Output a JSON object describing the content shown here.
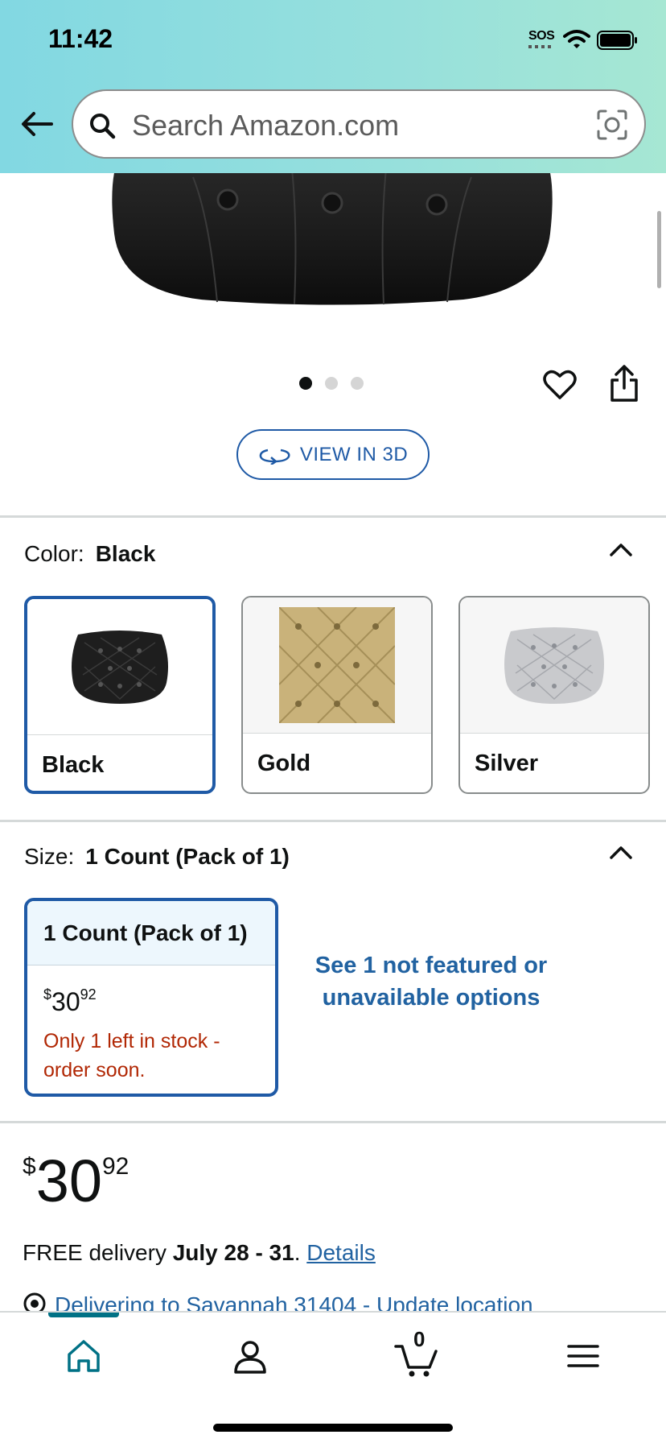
{
  "status_bar": {
    "time": "11:42",
    "sos": "SOS"
  },
  "search": {
    "placeholder": "Search Amazon.com"
  },
  "gallery": {
    "image_count": 3,
    "active_index": 0
  },
  "view_3d": {
    "label": "VIEW IN 3D"
  },
  "color": {
    "label": "Color:",
    "selected": "Black",
    "options": [
      {
        "label": "Black",
        "selected": true
      },
      {
        "label": "Gold",
        "selected": false
      },
      {
        "label": "Silver",
        "selected": false
      }
    ]
  },
  "size": {
    "label": "Size:",
    "selected": "1 Count (Pack of 1)",
    "card": {
      "title": "1 Count (Pack of 1)",
      "price_currency": "$",
      "price_whole": "30",
      "price_fraction": "92",
      "stock_note": "Only 1 left in stock - order soon."
    },
    "not_featured": "See 1 not featured or unavailable options"
  },
  "price": {
    "currency": "$",
    "whole": "30",
    "fraction": "92"
  },
  "delivery": {
    "prefix": "FREE delivery ",
    "dates": "July 28 - 31",
    "suffix": ". ",
    "details_link": "Details"
  },
  "location": {
    "text": "Delivering to Savannah 31404 - Update location"
  },
  "bottom_nav": {
    "cart_count": "0"
  },
  "colors": {
    "accent_blue": "#1f5aa6",
    "link_blue": "#2162a1",
    "stock_red": "#b12704",
    "nav_teal": "#007185"
  }
}
